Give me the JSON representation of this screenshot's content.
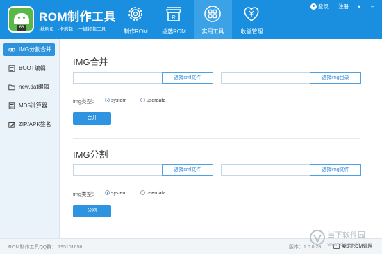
{
  "app": {
    "title": "ROM制作工具",
    "subtitle": [
      "·线刷包",
      "·卡刷包",
      "·一键打包工具"
    ],
    "logo_badge": "66"
  },
  "nav": {
    "tabs": [
      {
        "label": "制作ROM",
        "icon": "gear-icon"
      },
      {
        "label": "挑选ROM",
        "icon": "store-icon"
      },
      {
        "label": "实用工具",
        "icon": "grid-icon"
      },
      {
        "label": "收益管理",
        "icon": "yen-heart-icon"
      }
    ],
    "active_index": 2
  },
  "user": {
    "login": "登录",
    "register": "注册",
    "menu_glyph": "▾",
    "minimize_glyph": "–",
    "close_glyph": "✕"
  },
  "sidebar": {
    "items": [
      {
        "label": "IMG分割合并",
        "icon": "link-icon",
        "active": true
      },
      {
        "label": "BOOT编辑",
        "icon": "document-icon"
      },
      {
        "label": "new.dat编辑",
        "icon": "folder-icon"
      },
      {
        "label": "MD5计算器",
        "icon": "calculator-icon"
      },
      {
        "label": "ZIP/APK签名",
        "icon": "edit-icon"
      }
    ]
  },
  "merge": {
    "title": "IMG合并",
    "input1_value": "",
    "btn_select_xml": "选择xml文件",
    "input2_value": "",
    "btn_select_dir": "选择img目录",
    "type_label": "img类型：",
    "radio_system": "system",
    "radio_userdata": "userdata",
    "selected": "system",
    "action": "合并"
  },
  "split": {
    "title": "IMG分割",
    "input1_value": "",
    "btn_select_xml": "选择xml文件",
    "input2_value": "",
    "btn_select_img": "选择img文件",
    "type_label": "img类型：",
    "radio_system": "system",
    "radio_userdata": "userdata",
    "selected": "system",
    "action": "分割"
  },
  "footer": {
    "qq_label": "ROM制作工具QQ群：",
    "qq_number": "795101656",
    "version": "版本：1.0.0.28",
    "manager": "我的ROM管理"
  },
  "watermark": {
    "text_cn": "当下软件园",
    "text_url": "www.downxia.com"
  },
  "colors": {
    "header": "#1a8fe0",
    "active_tab": "#3ba2e8",
    "sidebar_bg": "#eaf2fa",
    "primary_button": "#2e93e0",
    "logo_green": "#5ab848"
  }
}
